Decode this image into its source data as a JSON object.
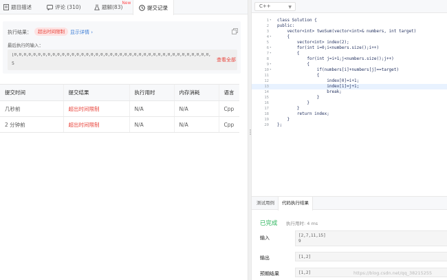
{
  "tabs": [
    {
      "label": "题目描述",
      "icon": "document-icon"
    },
    {
      "label": "评论 (310)",
      "icon": "comment-icon"
    },
    {
      "label": "题解(83)",
      "icon": "flask-icon",
      "badge": "New"
    },
    {
      "label": "提交记录",
      "icon": "clock-icon"
    }
  ],
  "result": {
    "label": "执行结果：",
    "status": "超出时间限制",
    "details_link": "显示详情 ›",
    "last_input_label": "最后执行的输入：",
    "last_input_line1": "[0,0,0,0,0,0,0,0,0,0,0,0,0,0,0,0,0,0,0,0,0,0,0,0,0,0,0,0,0,0,0,0,0,0,0,0,0,0,0,0,0,0,0,0,0,0,0,0,0,0,0,0,0,0,0,0,0,0,0,0,0,0...",
    "last_input_line2": "5",
    "view_all": "查看全部"
  },
  "submissions": {
    "headers": [
      "提交时间",
      "提交结果",
      "执行用时",
      "内存消耗",
      "语言"
    ],
    "rows": [
      [
        "几秒前",
        "超出时间限制",
        "N/A",
        "N/A",
        "Cpp"
      ],
      [
        "2 分钟前",
        "超出时间限制",
        "N/A",
        "N/A",
        "Cpp"
      ]
    ]
  },
  "editor": {
    "language": "C++",
    "lines": [
      "class Solution {",
      "public:",
      "    vector<int> twoSum(vector<int>& numbers, int target)",
      "    {",
      "        vector<int> index(2);",
      "        for(int i=0;i<numbers.size();i++)",
      "        {",
      "            for(int j=i+1;j<numbers.size();j++)",
      "            {",
      "                if(numbers[i]+numbers[j]==target)",
      "                {",
      "                    index[0]=i+1;",
      "                    index[1]=j+1;",
      "                    break;",
      "                }",
      "            }",
      "        }",
      "        return index;",
      "    }",
      "};"
    ],
    "highlighted_line": 13
  },
  "bottom": {
    "tabs": [
      "测试用例",
      "代码执行结果"
    ],
    "status": "已完成",
    "runtime": "执行用时: 4 ms",
    "input_label": "输入",
    "input_value": "[2,7,11,15]\n9",
    "output_label": "输出",
    "output_value": "[1,2]",
    "expected_label": "预期结果",
    "expected_value": "[1,2]",
    "watermark": "https://blog.csdn.net/qq_38215255"
  }
}
